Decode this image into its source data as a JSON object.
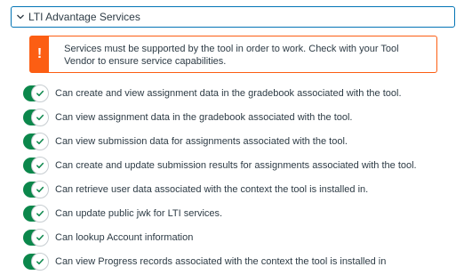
{
  "section": {
    "title": "LTI Advantage Services",
    "expanded": true,
    "chevron_icon": "chevron-down-icon"
  },
  "alert": {
    "icon": "!",
    "text": "Services must be supported by the tool in order to work. Check with your Tool Vendor to ensure service capabilities.",
    "color": "#fc5e13"
  },
  "permissions": [
    {
      "label": "Can create and view assignment data in the gradebook associated with the tool.",
      "enabled": true
    },
    {
      "label": "Can view assignment data in the gradebook associated with the tool.",
      "enabled": true
    },
    {
      "label": "Can view submission data for assignments associated with the tool.",
      "enabled": true
    },
    {
      "label": "Can create and update submission results for assignments associated with the tool.",
      "enabled": true
    },
    {
      "label": "Can retrieve user data associated with the context the tool is installed in.",
      "enabled": true
    },
    {
      "label": "Can update public jwk for LTI services.",
      "enabled": true
    },
    {
      "label": "Can lookup Account information",
      "enabled": true
    },
    {
      "label": "Can view Progress records associated with the context the tool is installed in",
      "enabled": true
    }
  ],
  "toggle_color": "#0b874b"
}
